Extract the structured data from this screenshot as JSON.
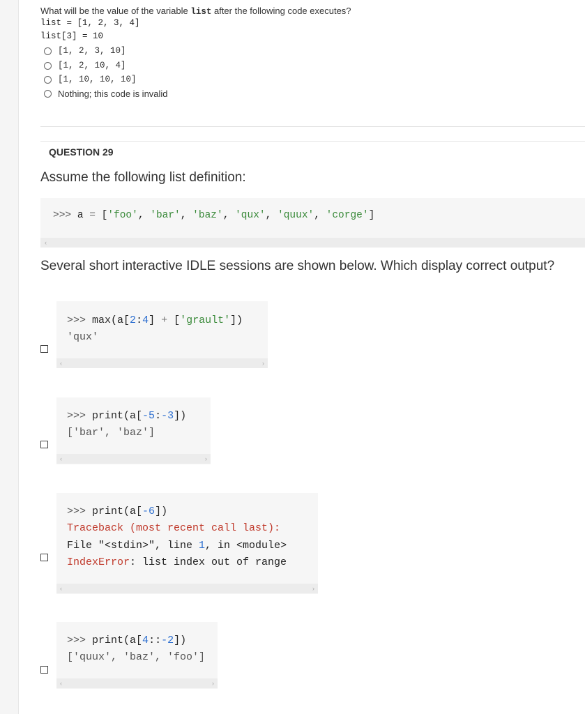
{
  "q28": {
    "prompt_before": "What will be the value of the variable ",
    "prompt_code": "list",
    "prompt_after": " after the following code executes?",
    "code_lines": [
      "list = [1, 2, 3, 4]",
      "list[3] = 10"
    ],
    "options": [
      {
        "label": "[1, 2, 3, 10]",
        "mono": true
      },
      {
        "label": "[1, 2, 10, 4]",
        "mono": true
      },
      {
        "label": "[1, 10, 10, 10]",
        "mono": true
      },
      {
        "label": "Nothing; this code is invalid",
        "mono": false
      }
    ]
  },
  "q29": {
    "header": "QUESTION 29",
    "intro": "Assume the following list definition:",
    "definition": {
      "prompt": ">>> ",
      "var": "a",
      "eq": " = ",
      "open": "[",
      "items": [
        "'foo'",
        "'bar'",
        "'baz'",
        "'qux'",
        "'quux'",
        "'corge'"
      ],
      "close": "]"
    },
    "question": "Several short interactive IDLE sessions are shown below. Which display correct output?",
    "sessions": [
      {
        "input": {
          "prompt": ">>> ",
          "func": "max",
          "open": "(a[",
          "n1": "2",
          "colon": ":",
          "n2": "4",
          "close": "] ",
          "plus": "+",
          "rest_open": " [",
          "str": "'grault'",
          "rest_close": "])"
        },
        "output": "'qux'"
      },
      {
        "input": {
          "prompt": ">>> ",
          "func": "print",
          "open": "(a[",
          "n1": "-5",
          "colon": ":",
          "n2": "-3",
          "close": "])"
        },
        "output": "['bar', 'baz']"
      },
      {
        "input": {
          "prompt": ">>> ",
          "func": "print",
          "open": "(a[",
          "n1": "-6",
          "close": "])"
        },
        "traceback_title": "Traceback (most recent call last):",
        "traceback_file_a": "File \"<stdin>\", line ",
        "traceback_line_no": "1",
        "traceback_file_b": ", in <module>",
        "error_name": "IndexError",
        "error_msg": ": list index out of range"
      },
      {
        "input": {
          "prompt": ">>> ",
          "func": "print",
          "open": "(a[",
          "n1": "4",
          "colon": "::",
          "n2": "-2",
          "close": "])"
        },
        "output": "['quux', 'baz', 'foo']"
      }
    ]
  },
  "icons": {
    "scroll_left": "chevron-left-icon",
    "scroll_right": "chevron-right-icon"
  }
}
